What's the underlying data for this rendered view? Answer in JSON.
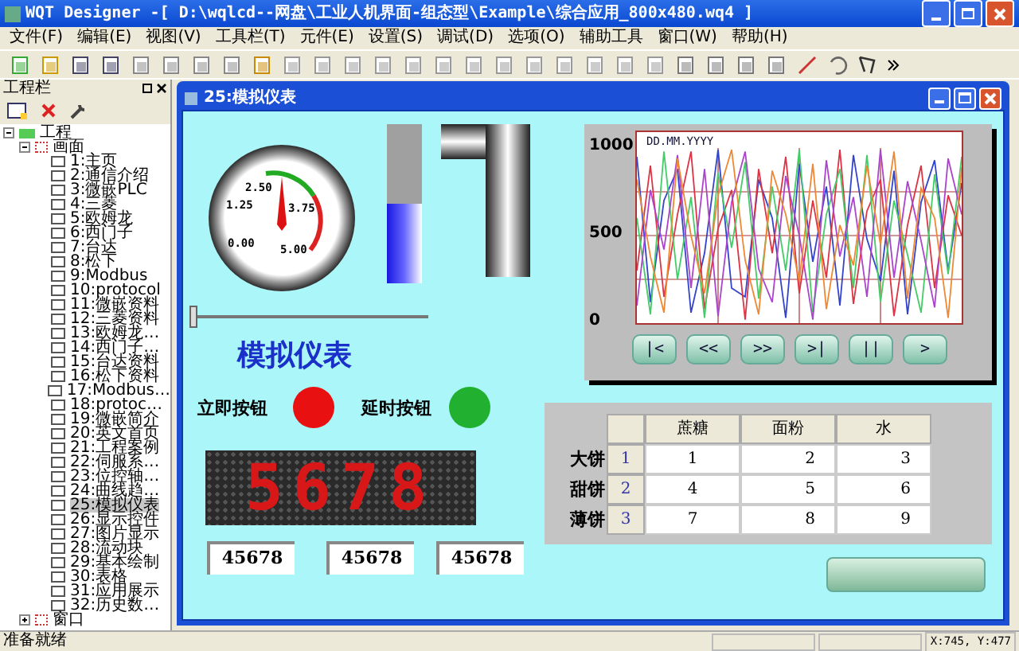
{
  "window": {
    "title": "WQT Designer -[ D:\\wqlcd--网盘\\工业人机界面-组态型\\Example\\综合应用_800x480.wq4 ]"
  },
  "menu": [
    "文件(F)",
    "编辑(E)",
    "视图(V)",
    "工具栏(T)",
    "元件(E)",
    "设置(S)",
    "调试(D)",
    "选项(O)",
    "辅助工具",
    "窗口(W)",
    "帮助(H)"
  ],
  "project_panel": {
    "title": "工程栏",
    "root": {
      "label": "工程",
      "expanded": true,
      "children": [
        {
          "label": "画面",
          "expanded": true,
          "children": [
            {
              "label": "1:主页",
              "selected": false
            },
            {
              "label": "2:通信介绍",
              "selected": false
            },
            {
              "label": "3:微嵌PLC",
              "selected": false
            },
            {
              "label": "4:三菱",
              "selected": false
            },
            {
              "label": "5:欧姆龙",
              "selected": false
            },
            {
              "label": "6:西门子",
              "selected": false
            },
            {
              "label": "7:台达",
              "selected": false
            },
            {
              "label": "8:松下",
              "selected": false
            },
            {
              "label": "9:Modbus",
              "selected": false
            },
            {
              "label": "10:protocol",
              "selected": false
            },
            {
              "label": "11:微嵌资料",
              "selected": false
            },
            {
              "label": "12:三菱资料",
              "selected": false
            },
            {
              "label": "13:欧姆龙…",
              "selected": false
            },
            {
              "label": "14:西门子…",
              "selected": false
            },
            {
              "label": "15:台达资料",
              "selected": false
            },
            {
              "label": "16:松下资料",
              "selected": false
            },
            {
              "label": "17:Modbus…",
              "selected": false
            },
            {
              "label": "18:protoc…",
              "selected": false
            },
            {
              "label": "19:微嵌简介",
              "selected": false
            },
            {
              "label": "20:英文首页",
              "selected": false
            },
            {
              "label": "21:工程案例",
              "selected": false
            },
            {
              "label": "22:伺服系…",
              "selected": false
            },
            {
              "label": "23:位控轴…",
              "selected": false
            },
            {
              "label": "24:曲线趋…",
              "selected": false
            },
            {
              "label": "25:模拟仪表",
              "selected": true
            },
            {
              "label": "26:显示控件",
              "selected": false
            },
            {
              "label": "27:图片显示",
              "selected": false
            },
            {
              "label": "28:流动块",
              "selected": false
            },
            {
              "label": "29:基本绘制",
              "selected": false
            },
            {
              "label": "30:表格",
              "selected": false
            },
            {
              "label": "31:应用展示",
              "selected": false
            },
            {
              "label": "32:历史数…",
              "selected": false
            }
          ]
        },
        {
          "label": "窗口",
          "expanded": false
        }
      ]
    }
  },
  "screen_window": {
    "title": "25:模拟仪表",
    "gauge": {
      "labels": [
        "0.00",
        "1.25",
        "2.50",
        "3.75",
        "5.00"
      ]
    },
    "bar_meter": {
      "level": 0.5
    },
    "slider": {
      "level": 0
    },
    "heading": "模拟仪表",
    "lamps": [
      {
        "label": "立即按钮",
        "color": "#e81010"
      },
      {
        "label": "延时按钮",
        "color": "#22b030"
      }
    ],
    "led_display": "5678",
    "numeric_displays": [
      "45678",
      "45678",
      "45678"
    ],
    "trend": {
      "date_label": "DD.MM.YYYY",
      "buttons": [
        "|<",
        "<<",
        ">>",
        ">|",
        "||",
        ">"
      ],
      "chart_data": {
        "type": "line",
        "grid": true,
        "ylim": [
          0,
          1000
        ],
        "yticks": [
          0,
          500,
          1000
        ],
        "series": [
          {
            "color": "#3344cc",
            "values": [
              950,
              120,
              700,
              880,
              60,
              400,
              990,
              200,
              150,
              820,
              600,
              30,
              910,
              350,
              780,
              100,
              960,
              480,
              240,
              870,
              50,
              690,
              930,
              300,
              800
            ]
          },
          {
            "color": "#dd3344",
            "values": [
              300,
              900,
              150,
              620,
              980,
              80,
              540,
              760,
              20,
              880,
              400,
              950,
              170,
              700,
              260,
              990,
              110,
              640,
              820,
              40,
              560,
              900,
              200,
              730,
              500
            ]
          },
          {
            "color": "#44cc66",
            "values": [
              600,
              50,
              980,
              250,
              720,
              30,
              860,
              430,
              920,
              140,
              780,
              300,
              990,
              60,
              620,
              880,
              200,
              960,
              120,
              700,
              390,
              60,
              850,
              280,
              950
            ]
          },
          {
            "color": "#aa44cc",
            "values": [
              100,
              760,
              420,
              960,
              200,
              880,
              40,
              690,
              980,
              310,
              120,
              840,
              500,
              20,
              930,
              380,
              720,
              150,
              990,
              260,
              810,
              470,
              90,
              940,
              620
            ]
          },
          {
            "color": "#ee8833",
            "values": [
              820,
              380,
              60,
              940,
              500,
              170,
              730,
              990,
              360,
              50,
              870,
              620,
              240,
              910,
              80,
              560,
              330,
              900,
              450,
              980,
              140,
              770,
              600,
              30,
              890
            ]
          }
        ]
      }
    },
    "table": {
      "columns": [
        "",
        "",
        "蔗糖",
        "面粉",
        "水"
      ],
      "rows": [
        {
          "cells": [
            "大饼",
            "1",
            "1",
            "2",
            "3"
          ]
        },
        {
          "cells": [
            "甜饼",
            "2",
            "4",
            "5",
            "6"
          ]
        },
        {
          "cells": [
            "薄饼",
            "3",
            "7",
            "8",
            "9"
          ]
        }
      ]
    }
  },
  "status_bar": {
    "message": "准备就绪",
    "coords": "X:745, Y:477"
  }
}
